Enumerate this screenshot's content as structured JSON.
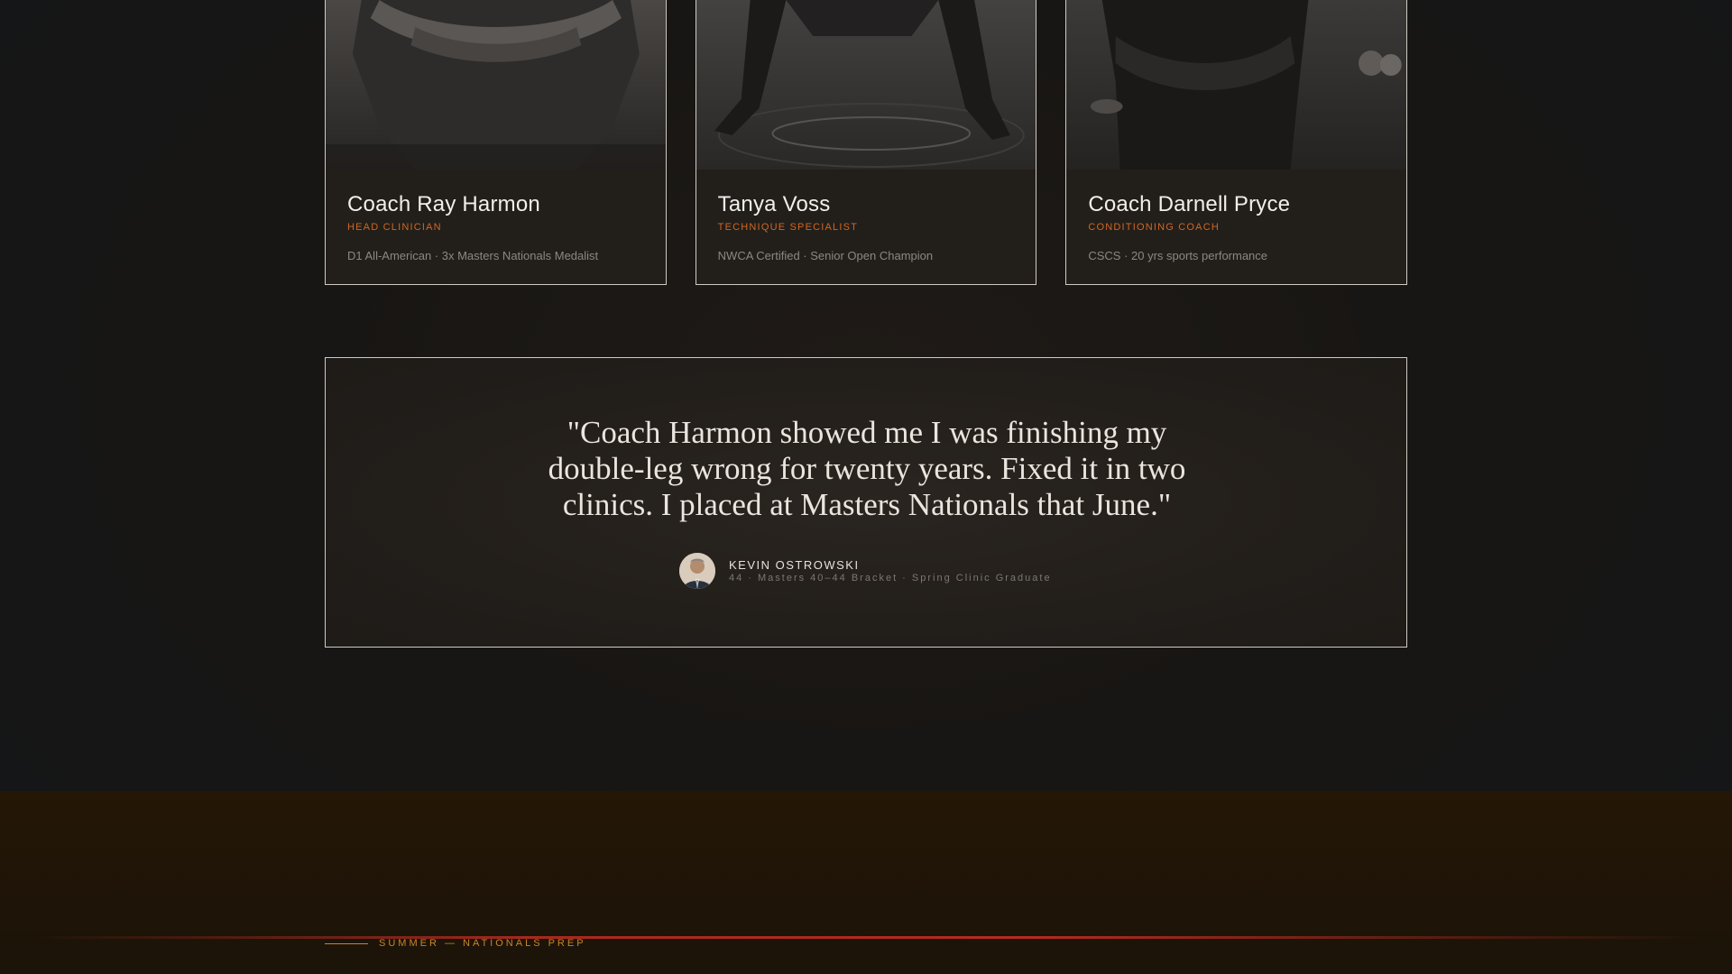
{
  "coaches": [
    {
      "name": "Coach Ray Harmon",
      "role": "HEAD CLINICIAN",
      "credentials": "D1 All-American · 3x Masters Nationals Medalist",
      "photo_icon": "coach-photo-arms-crossed"
    },
    {
      "name": "Tanya Voss",
      "role": "TECHNIQUE SPECIALIST",
      "credentials": "NWCA Certified · Senior Open Champion",
      "photo_icon": "coach-photo-wrestling-stance"
    },
    {
      "name": "Coach Darnell Pryce",
      "role": "CONDITIONING COACH",
      "credentials": "CSCS · 20 yrs sports performance",
      "photo_icon": "coach-photo-arms-crossed"
    }
  ],
  "testimonial": {
    "quote": "\"Coach Harmon showed me I was finishing my double-leg wrong for twenty years. Fixed it in two clinics. I placed at Masters Nationals that June.\"",
    "author_name": "KEVIN OSTROWSKI",
    "author_meta": "44 · Masters 40–44 Bracket · Spring Clinic Graduate",
    "avatar_icon": "avatar-portrait"
  },
  "next_section": {
    "label": "SUMMER — NATIONALS PREP"
  },
  "colors": {
    "accent_orange": "#d2661f",
    "label_gold": "#c8852a",
    "divider_red": "#b52a20",
    "card_border": "#cfcac3"
  }
}
